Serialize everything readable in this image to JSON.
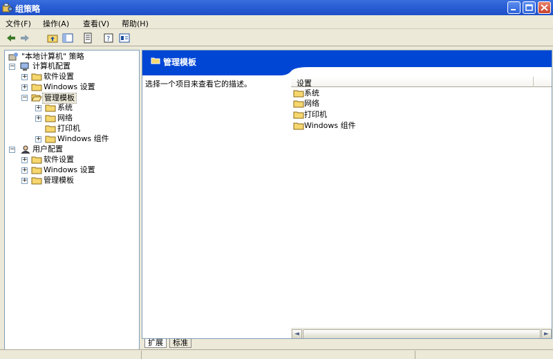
{
  "window": {
    "title": "组策略"
  },
  "menu": [
    "文件(F)",
    "操作(A)",
    "查看(V)",
    "帮助(H)"
  ],
  "tree": {
    "root": "\"本地计算机\" 策略",
    "computer": {
      "label": "计算机配置",
      "children": [
        "软件设置",
        "Windows 设置",
        "管理模板"
      ],
      "admin_children": [
        "系统",
        "网络",
        "打印机",
        "Windows 组件"
      ]
    },
    "user": {
      "label": "用户配置",
      "children": [
        "软件设置",
        "Windows 设置",
        "管理模板"
      ]
    }
  },
  "right": {
    "header_title": "管理模板",
    "description": "选择一个项目来查看它的描述。",
    "column_header": "设置",
    "items": [
      "系统",
      "网络",
      "打印机",
      "Windows 组件"
    ]
  },
  "tabs": [
    "扩展",
    "标准"
  ],
  "colors": {
    "title_bar": "#2a5fd6",
    "header_band": "#0046d5",
    "folder": "#f5d76e"
  }
}
